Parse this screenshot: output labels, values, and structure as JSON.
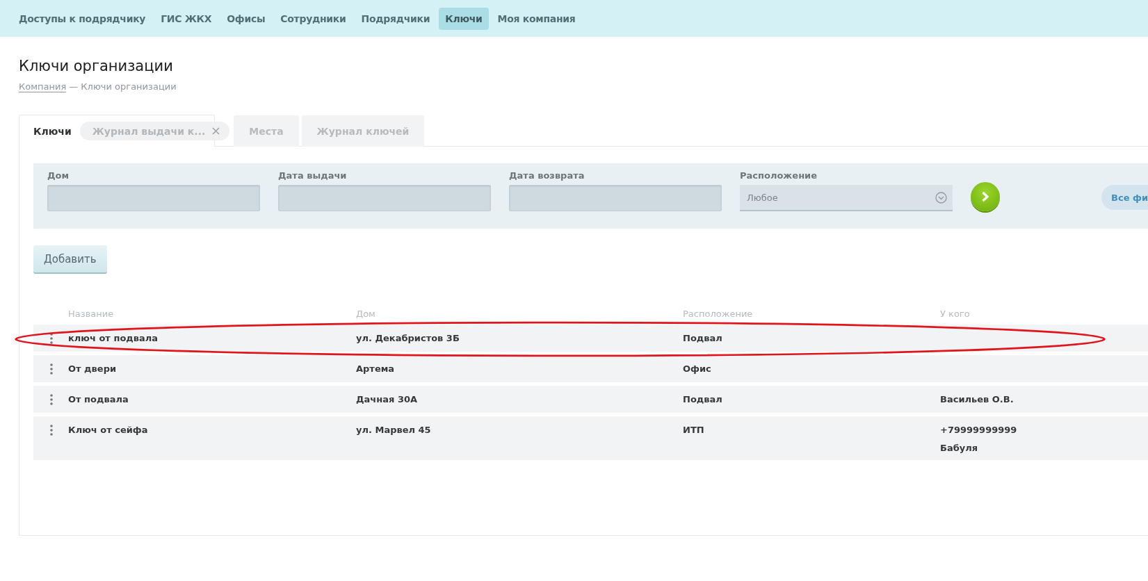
{
  "nav": {
    "items": [
      {
        "label": "Доступы к подрядчику",
        "selected": false
      },
      {
        "label": "ГИС ЖКХ",
        "selected": false
      },
      {
        "label": "Офисы",
        "selected": false
      },
      {
        "label": "Сотрудники",
        "selected": false
      },
      {
        "label": "Подрядчики",
        "selected": false
      },
      {
        "label": "Ключи",
        "selected": true
      },
      {
        "label": "Моя компания",
        "selected": false
      }
    ]
  },
  "page": {
    "title": "Ключи организации",
    "breadcrumb": {
      "link": "Компания",
      "current": "— Ключи организации"
    }
  },
  "tabs": [
    {
      "label": "Ключи",
      "selected": true,
      "kind": "tab"
    },
    {
      "label": "Журнал выдачи к...",
      "selected": false,
      "kind": "closable"
    },
    {
      "label": "Места",
      "selected": false,
      "kind": "tab"
    },
    {
      "label": "Журнал ключей",
      "selected": false,
      "kind": "tab"
    }
  ],
  "filters": {
    "fields": [
      {
        "label": "Дом",
        "kind": "input"
      },
      {
        "label": "Дата выдачи",
        "kind": "input"
      },
      {
        "label": "Дата возврата",
        "kind": "input"
      },
      {
        "label": "Расположение",
        "kind": "select",
        "value": "Любое"
      }
    ],
    "all_filters": "Все фи"
  },
  "add_button": "Добавить",
  "table": {
    "columns": [
      "Название",
      "Дом",
      "Расположение",
      "У кого"
    ],
    "rows": [
      {
        "cells": [
          "ключ от подвала",
          "ул. Декабристов 3Б",
          "Подвал",
          []
        ],
        "highlighted": true
      },
      {
        "cells": [
          "От двери",
          "Артема",
          "Офис",
          []
        ],
        "highlighted": false
      },
      {
        "cells": [
          "От подвала",
          "Дачная 30А",
          "Подвал",
          [
            "Васильев О.В."
          ]
        ],
        "highlighted": false
      },
      {
        "cells": [
          "Ключ от сейфа",
          "ул. Марвел 45",
          "ИТП",
          [
            "+79999999999",
            "Бабуля"
          ]
        ],
        "highlighted": false
      }
    ]
  }
}
